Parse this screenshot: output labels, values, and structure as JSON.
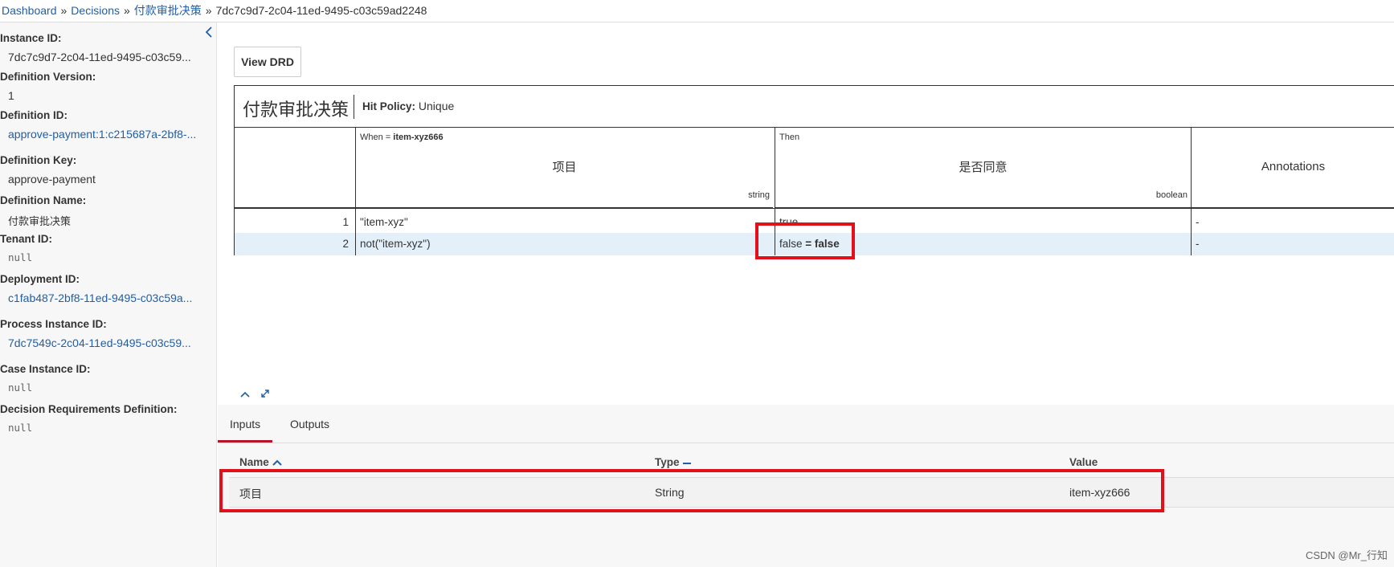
{
  "breadcrumb": {
    "items": [
      "Dashboard",
      "Decisions",
      "付款审批决策"
    ],
    "current": "7dc7c9d7-2c04-11ed-9495-c03c59ad2248",
    "separator": "»"
  },
  "sidebar": {
    "collapse_icon": "chevron-left-icon",
    "fields": [
      {
        "label": "Instance ID:",
        "value": "7dc7c9d7-2c04-11ed-9495-c03c59..."
      },
      {
        "label": "Definition Version:",
        "value": "1"
      },
      {
        "label": "Definition ID:",
        "value": "approve-payment:1:c215687a-2bf8-..."
      },
      {
        "label": "Definition Key:",
        "value": "approve-payment"
      },
      {
        "label": "Definition Name:",
        "value": "付款审批决策"
      },
      {
        "label": "Tenant ID:",
        "value": "null"
      },
      {
        "label": "Deployment ID:",
        "value": "c1fab487-2bf8-11ed-9495-c03c59a..."
      },
      {
        "label": "Process Instance ID:",
        "value": "7dc7549c-2c04-11ed-9495-c03c59..."
      },
      {
        "label": "Case Instance ID:",
        "value": "null"
      },
      {
        "label": "Decision Requirements Definition:",
        "value": "null"
      }
    ]
  },
  "view_drd_label": "View DRD",
  "decision_table": {
    "name": "付款审批决策",
    "hit_policy_label": "Hit Policy:",
    "hit_policy": "Unique",
    "input": {
      "when_prefix": "When = ",
      "when_value": "item-xyz666",
      "title": "项目",
      "type": "string"
    },
    "output": {
      "then": "Then",
      "title": "是否同意",
      "type": "boolean"
    },
    "annotations_label": "Annotations",
    "rows": [
      {
        "num": "1",
        "input": "\"item-xyz\"",
        "output": "true",
        "output_eval": "",
        "annotation": "-"
      },
      {
        "num": "2",
        "input": "not(\"item-xyz\")",
        "output": "false",
        "output_eval": "= false",
        "annotation": "-"
      }
    ]
  },
  "controls": {
    "collapse_icon": "chevron-up-icon",
    "expand_icon": "expand-icon"
  },
  "tabs": [
    "Inputs",
    "Outputs"
  ],
  "inputs_table": {
    "headers": {
      "name": "Name",
      "type": "Type",
      "value": "Value"
    },
    "rows": [
      {
        "name": "项目",
        "type": "String",
        "value": "item-xyz666"
      }
    ]
  },
  "watermark": "CSDN @Mr_行知",
  "colors": {
    "accent": "#1f5ea8",
    "highlight": "#e1101b",
    "active_tab": "#b5152b",
    "row_highlight": "#e3f0fa"
  }
}
